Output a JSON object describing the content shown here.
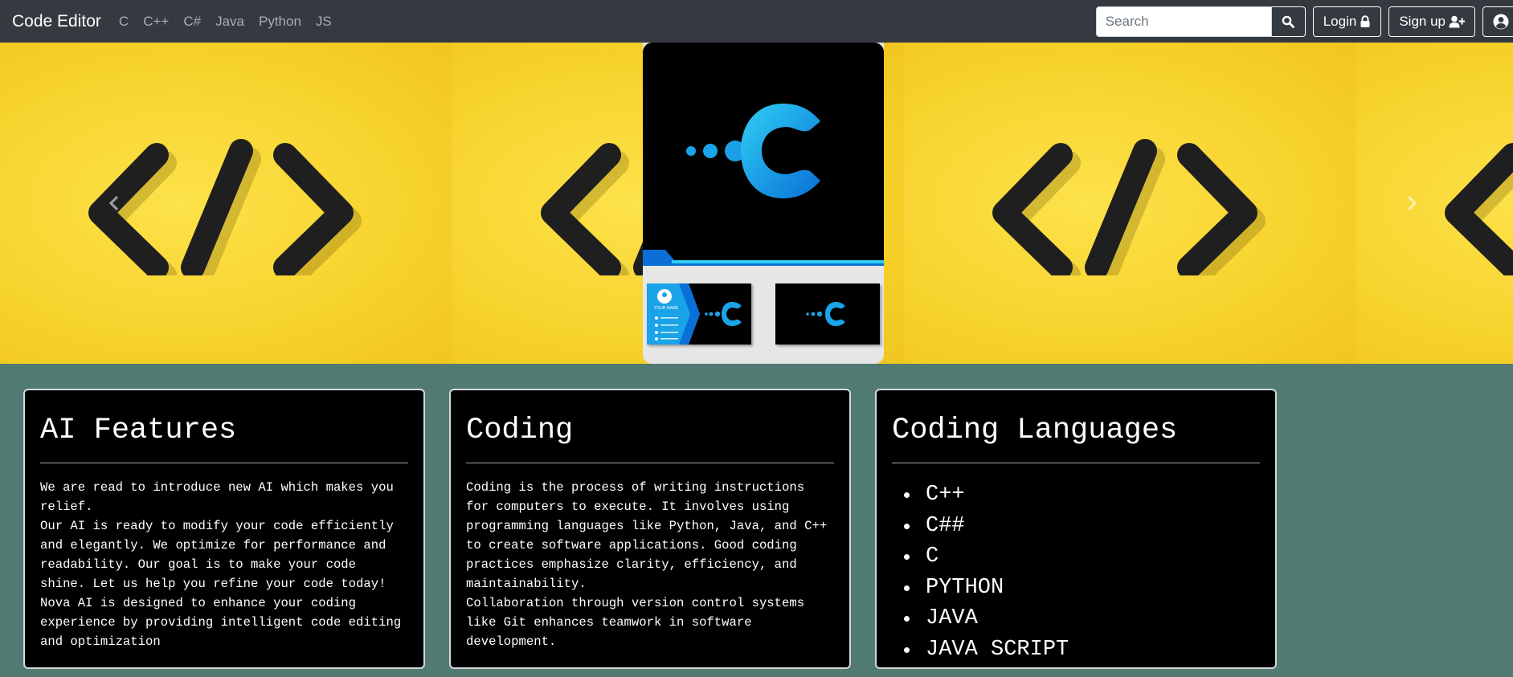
{
  "navbar": {
    "brand": "Code Editor",
    "links": [
      "C",
      "C++",
      "C#",
      "Java",
      "Python",
      "JS"
    ],
    "search": {
      "placeholder": "Search",
      "value": ""
    },
    "login_label": "Login",
    "signup_label": "Sign up",
    "icons": {
      "search": "search-icon",
      "login": "lock-icon",
      "signup": "user-plus-icon",
      "account": "user-circle-icon"
    }
  },
  "carousel": {
    "prev_icon": "chevron-left-icon",
    "next_icon": "chevron-right-icon",
    "center_card": {
      "logo_icon": "c-logo-icon",
      "thumbnail_1_text": "YOUR NAME",
      "thumbnail_2": "c-logo"
    }
  },
  "sections": {
    "ai": {
      "title": "AI Features",
      "paragraphs": [
        "We are read to introduce new AI which makes you relief.",
        "Our AI is ready to modify your code efficiently and elegantly. We optimize for performance and readability. Our goal is to make your code shine. Let us help you refine your code today!",
        "Nova AI is designed to enhance your coding experience by providing intelligent code editing and optimization"
      ]
    },
    "coding": {
      "title": "Coding",
      "paragraphs": [
        "Coding is the process of writing instructions for computers to execute. It involves using programming languages like Python, Java, and C++ to create software applications. Good coding practices emphasize clarity, efficiency, and maintainability.",
        "Collaboration through version control systems like Git enhances teamwork in software development."
      ]
    },
    "languages": {
      "title": "Coding Languages",
      "items": [
        "C++",
        "C##",
        "C",
        "PYTHON",
        "JAVA",
        "JAVA SCRIPT"
      ]
    }
  },
  "colors": {
    "navbar": "#343a40",
    "carousel_bg": "#f7d633",
    "section_bg": "#517a72",
    "panel_bg": "#000000",
    "accent": "#1aa3e8"
  }
}
